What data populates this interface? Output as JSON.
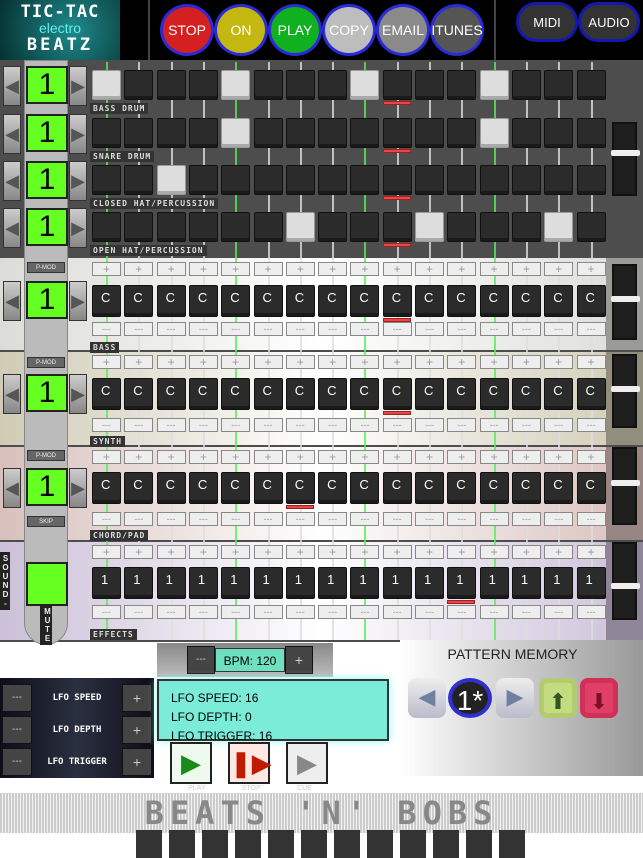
{
  "logo": {
    "line1": "TIC-TAC",
    "line2": "electro",
    "line3": "BEATZ"
  },
  "transport": [
    {
      "label": "STOP",
      "color": "#d42020"
    },
    {
      "label": "ON",
      "color": "#c4b810"
    },
    {
      "label": "PLAY",
      "color": "#10b020"
    },
    {
      "label": "COPY",
      "color": "#bdbdbd"
    },
    {
      "label": "EMAIL",
      "color": "#8a8a8a"
    },
    {
      "label": "ITUNES",
      "color": "#555555"
    }
  ],
  "output": [
    {
      "label": "MIDI"
    },
    {
      "label": "AUDIO"
    }
  ],
  "steps": 16,
  "drums": [
    {
      "label": "BASS DRUM",
      "pattern_number": "1",
      "active_steps": [
        0,
        4,
        8,
        12
      ]
    },
    {
      "label": "SNARE DRUM",
      "pattern_number": "1",
      "active_steps": [
        4,
        12
      ]
    },
    {
      "label": "CLOSED HAT/PERCUSSION",
      "pattern_number": "1",
      "active_steps": [
        2
      ]
    },
    {
      "label": "OPEN HAT/PERCUSSION",
      "pattern_number": "1",
      "active_steps": [
        6,
        10,
        14
      ]
    }
  ],
  "playhead_step": 9,
  "melodic": [
    {
      "label": "BASS",
      "pattern_number": "1",
      "mod_label": "P-MOD",
      "note": "C",
      "marker_step": 9,
      "bg": "#dcdcd8",
      "slider_level": 0.4
    },
    {
      "label": "SYNTH",
      "pattern_number": "1",
      "mod_label": "P-MOD",
      "note": "C",
      "marker_step": 9,
      "bg": "#cfcbb4",
      "slider_level": 0.4
    },
    {
      "label": "CHORD/PAD",
      "pattern_number": "1",
      "mod_label": "P-MOD",
      "note": "C",
      "marker_step": 6,
      "bg": "#d8c0bc",
      "slider_level": 0.4,
      "extra_label": "SKIP"
    },
    {
      "label": "EFFECTS",
      "pattern_number": "",
      "note": "1",
      "marker_step": 11,
      "bg": "#cbc0d8",
      "slider_level": 0.5
    }
  ],
  "sound_label": "SOUND-",
  "mute_label": "MUTE",
  "plus_glyph": "+",
  "minus_glyph": "---",
  "bpm": {
    "label": "BPM: 120"
  },
  "lfo": {
    "rows": [
      "LFO SPEED",
      "LFO DEPTH",
      "LFO TRIGGER"
    ],
    "info": [
      "LFO SPEED: 16",
      "LFO DEPTH: 0",
      "LFO TRIGGER: 16"
    ]
  },
  "player": [
    {
      "icon": "play-icon",
      "label": "PLAY"
    },
    {
      "icon": "stop-icon",
      "label": "STOP"
    },
    {
      "icon": "cue-icon",
      "label": "CUE"
    }
  ],
  "pattern_memory": {
    "title": "PATTERN MEMORY",
    "current": "1*"
  },
  "banner": "BEATS 'N' BOBS"
}
